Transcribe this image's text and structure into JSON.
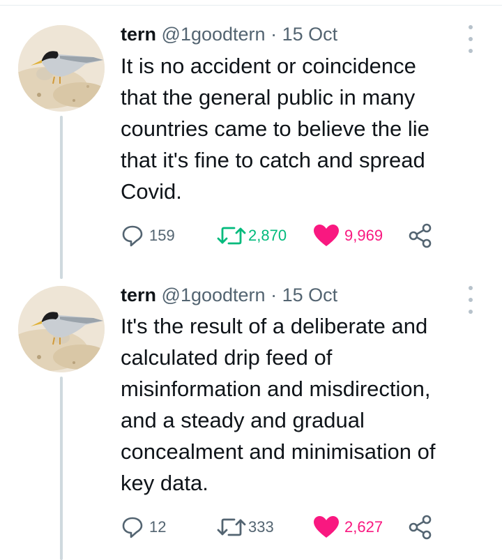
{
  "tweets": [
    {
      "name": "tern",
      "handle": "@1goodtern",
      "separator": "·",
      "date": "15 Oct",
      "lines": [
        "It is no accident or coincidence",
        "that the general public in many",
        "countries came to believe the lie",
        "that it's fine to catch and spread",
        "Covid."
      ],
      "replies": "159",
      "retweets": "2,870",
      "likes": "9,969",
      "retweeted": true,
      "liked": true
    },
    {
      "name": "tern",
      "handle": "@1goodtern",
      "separator": "·",
      "date": "15 Oct",
      "lines": [
        "It's the result of a deliberate and",
        "calculated drip feed of",
        "misinformation and misdirection,",
        "and a steady and gradual",
        "concealment and minimisation of",
        "key data."
      ],
      "replies": "12",
      "retweets": "333",
      "likes": "2,627",
      "retweeted": false,
      "liked": true
    }
  ],
  "icons": {
    "reply": "reply-bubble-icon",
    "retweet": "retweet-arrows-icon",
    "like": "heart-icon",
    "share": "share-icon",
    "more": "more-vertical-icon"
  },
  "colors": {
    "text": "#0f1419",
    "muted": "#536471",
    "retweet_active": "#00ba7c",
    "like_active": "#f91880",
    "thread_line": "#cfd9de"
  }
}
